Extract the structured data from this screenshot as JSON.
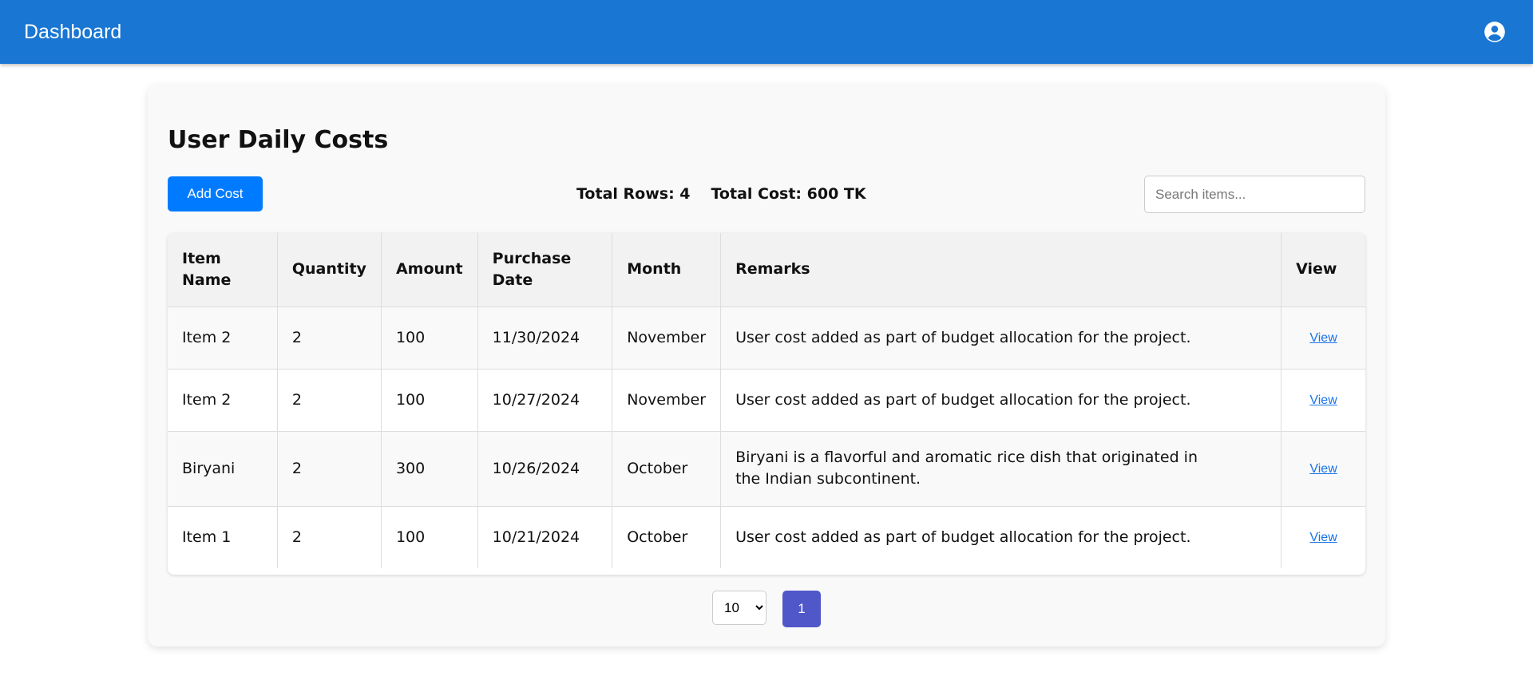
{
  "appbar": {
    "title": "Dashboard",
    "account_icon": "account-circle-icon"
  },
  "page": {
    "title": "User Daily Costs"
  },
  "toolbar": {
    "add_label": "Add Cost",
    "total_rows": "Total Rows: 4",
    "total_cost": "Total Cost: 600 TK",
    "search_placeholder": "Search items..."
  },
  "table": {
    "headers": [
      "Item Name",
      "Quantity",
      "Amount",
      "Purchase Date",
      "Month",
      "Remarks",
      "View"
    ],
    "rows": [
      {
        "item": "Item 2",
        "quantity": "2",
        "amount": "100",
        "date": "11/30/2024",
        "month": "November",
        "remarks": "User cost added as part of budget allocation for the project.",
        "view": "View"
      },
      {
        "item": "Item 2",
        "quantity": "2",
        "amount": "100",
        "date": "10/27/2024",
        "month": "November",
        "remarks": "User cost added as part of budget allocation for the project.",
        "view": "View"
      },
      {
        "item": "Biryani",
        "quantity": "2",
        "amount": "300",
        "date": "10/26/2024",
        "month": "October",
        "remarks": "Biryani is a flavorful and aromatic rice dish that originated in the Indian subcontinent.",
        "view": "View"
      },
      {
        "item": "Item 1",
        "quantity": "2",
        "amount": "100",
        "date": "10/21/2024",
        "month": "October",
        "remarks": "User cost added as part of budget allocation for the project.",
        "view": "View"
      }
    ]
  },
  "pagination": {
    "page_size": "10",
    "current_page": "1"
  },
  "colors": {
    "appbar": "#1976d2",
    "primary_button": "#007bff",
    "page_button": "#5057c9",
    "link": "#1a73e8"
  }
}
